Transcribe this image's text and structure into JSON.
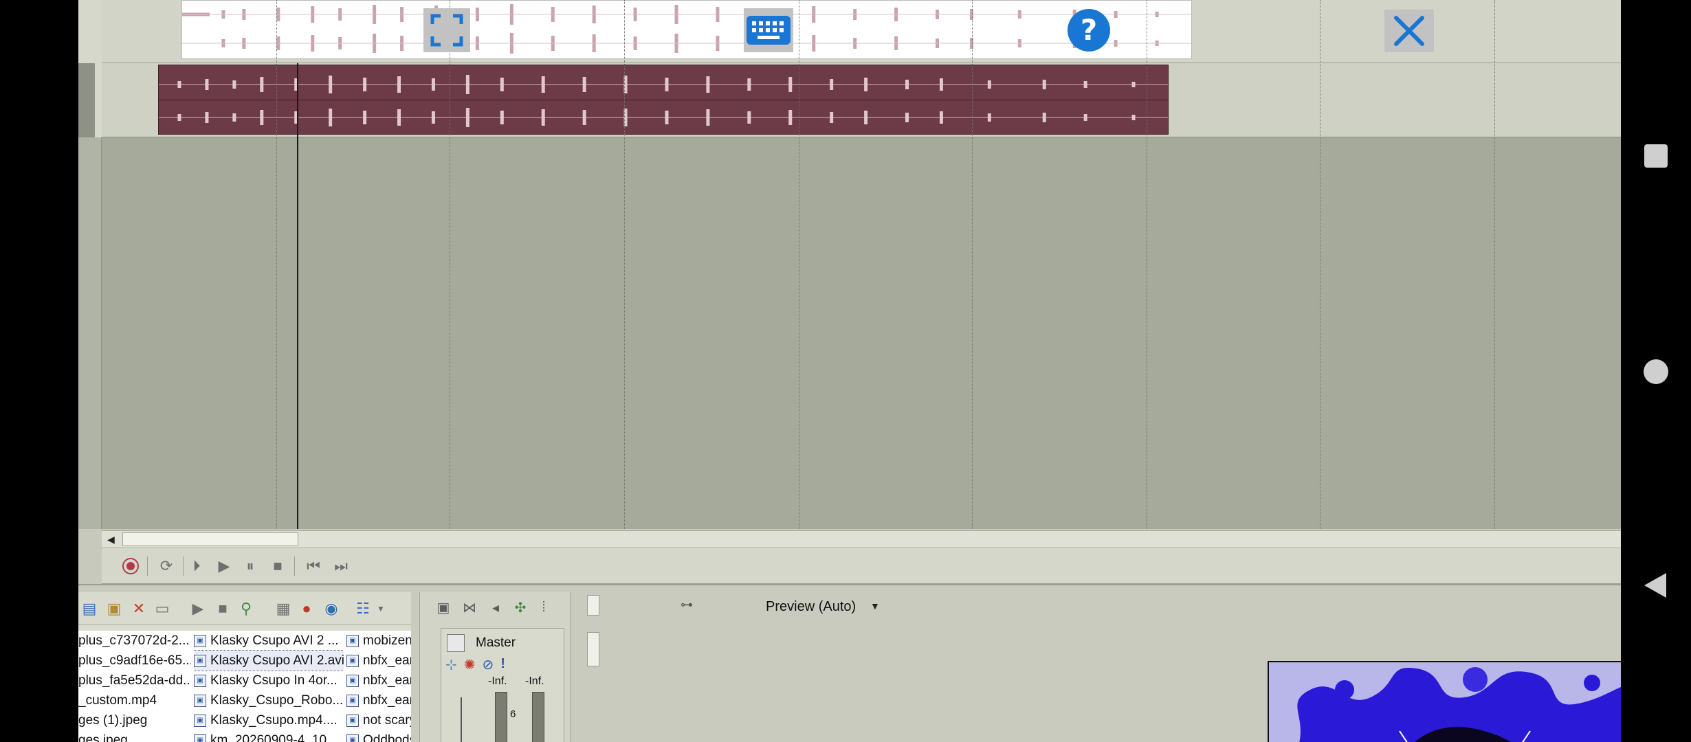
{
  "overlay": {
    "fullscreen_icon": "fullscreen-icon",
    "keyboard_icon": "keyboard-icon",
    "help_icon": "help-icon",
    "close_icon": "close-icon",
    "accent": "#1976d2"
  },
  "colors": {
    "audio_clip": "#6d3a48",
    "track_bg": "#a5aa9a",
    "panel_bg": "#c9cbbf"
  },
  "explorer": {
    "columns": [
      [
        {
          "name": "plus_c737072d-2..."
        },
        {
          "name": "plus_c9adf16e-65..."
        },
        {
          "name": "plus_fa5e52da-dd..."
        },
        {
          "name": "_custom.mp4"
        },
        {
          "name": "ges (1).jpeg"
        },
        {
          "name": "ges.jpeg"
        }
      ],
      [
        {
          "name": "Klasky Csupo AVI 2 ..."
        },
        {
          "name": "Klasky Csupo AVI 2.avi",
          "selected": true
        },
        {
          "name": "Klasky Csupo In 4or..."
        },
        {
          "name": "Klasky_Csupo_Robo..."
        },
        {
          "name": "Klasky_Csupo.mp4...."
        },
        {
          "name": "km_20260909-4_10..."
        }
      ],
      [
        {
          "name": "mobizen_"
        },
        {
          "name": "nbfx_ear"
        },
        {
          "name": "nbfx_ear"
        },
        {
          "name": "nbfx_ear"
        },
        {
          "name": "not scary"
        },
        {
          "name": "Oddbods"
        }
      ]
    ]
  },
  "mixer": {
    "master_label": "Master",
    "meter_left": "-Inf.",
    "meter_right": "-Inf.",
    "scale_mark": "6"
  },
  "preview": {
    "mode_label": "Preview (Auto)"
  }
}
